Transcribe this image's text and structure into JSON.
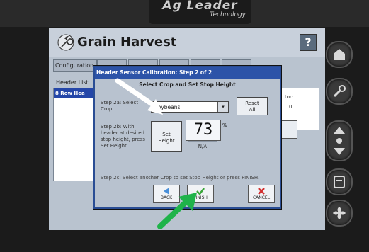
{
  "device": {
    "brand": "Ag Leader",
    "brand_sub": "Technology"
  },
  "app": {
    "title": "Grain Harvest",
    "help_label": "?"
  },
  "background": {
    "tab_label": "Configuration",
    "header_list_label": "Header List",
    "selected_header": "8 Row Hea",
    "right_panel_text": "tor:",
    "right_panel_value": "0"
  },
  "dialog": {
    "title": "Header Sensor Calibration: Step 2 of 2",
    "heading": "Select Crop and Set Stop Height",
    "step2a_label": "Step 2a: Select Crop:",
    "crop_value": "Soybeans",
    "reset_label_1": "Reset",
    "reset_label_2": "All",
    "step2b_label": "Step 2b: With header at desired stop height, press Set Height",
    "set_height_label_1": "Set",
    "set_height_label_2": "Height",
    "height_value": "73",
    "height_unit": "%",
    "height_status": "N/A",
    "step2c_label": "Step 2c: Select another Crop to set Stop Height or press FINISH.",
    "buttons": {
      "back": "BACK",
      "finish": "FINISH",
      "cancel": "CANCEL"
    }
  },
  "icons": {
    "side_buttons": [
      "map-icon",
      "wrench-icon",
      "brightness-icon",
      "page-icon",
      "fan-icon"
    ]
  },
  "colors": {
    "dialog_title_bar": "#2c53a8",
    "selection": "#2446a8",
    "finish_check": "#3aa63a",
    "cancel_x": "#d23030",
    "back_arrow": "#4a8fd8"
  }
}
